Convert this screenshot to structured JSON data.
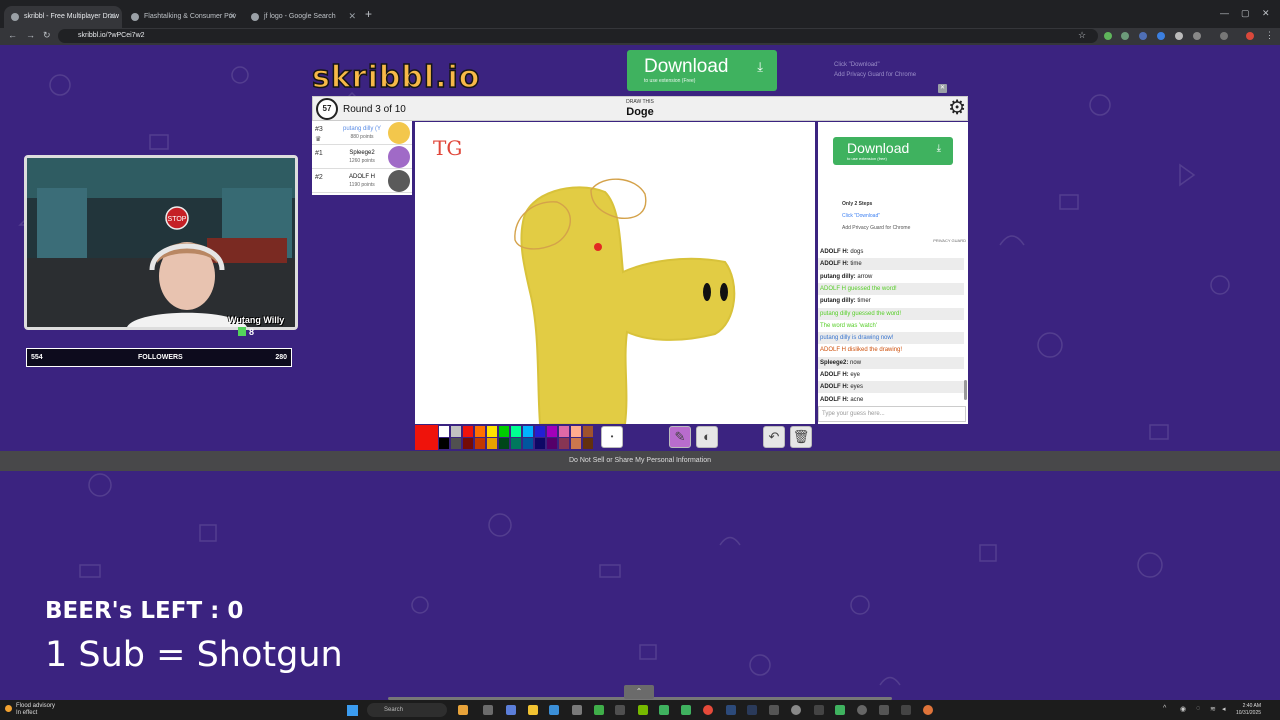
{
  "browser": {
    "tabs": [
      {
        "title": "skribbl - Free Multiplayer Draw",
        "active": true
      },
      {
        "title": "Flashtalking & Consumer Priv",
        "active": false
      },
      {
        "title": "jf logo - Google Search",
        "active": false
      }
    ],
    "url": "skribbl.io/?wPCei7w2"
  },
  "game": {
    "logo": "skribbl.io",
    "download": {
      "label": "Download",
      "sub": "to use extension (Free)"
    },
    "ad_note": {
      "line1": "Click \"Download\"",
      "line2": "Add Privacy Guard for Chrome"
    },
    "timer": "57",
    "round": "Round 3 of 10",
    "draw_this": "DRAW THIS",
    "word": "Doge",
    "players": [
      {
        "rank": "#3",
        "name": "putang dilly (Y",
        "points": "880 points",
        "me": true,
        "color": "#f3c74c"
      },
      {
        "rank": "#1",
        "name": "Spleege2",
        "points": "1260 points",
        "me": false,
        "color": "#a06ac7"
      },
      {
        "rank": "#2",
        "name": "ADOLF H",
        "points": "1190 points",
        "me": false,
        "color": "#5a5a5a"
      }
    ],
    "canvas_text": "TG",
    "side_ad": {
      "download": "Download",
      "download_sub": "to use extension (free)",
      "steps_title": "Only 2 Steps",
      "step1": "Click \"Download\"",
      "step2": "Add Privacy Guard for Chrome",
      "brand": "PRIVACY GUARD"
    },
    "chat": [
      {
        "user": "ADOLF H:",
        "msg": "dogs",
        "style": "normal"
      },
      {
        "user": "ADOLF H:",
        "msg": "time",
        "style": "normal"
      },
      {
        "user": "putang dilly:",
        "msg": "arrow",
        "style": "normal"
      },
      {
        "user": "",
        "msg": "ADOLF H guessed the word!",
        "style": "green"
      },
      {
        "user": "putang dilly:",
        "msg": "timer",
        "style": "normal"
      },
      {
        "user": "",
        "msg": "putang dilly guessed the word!",
        "style": "green"
      },
      {
        "user": "",
        "msg": "The word was 'watch'",
        "style": "green"
      },
      {
        "user": "",
        "msg": "putang dilly is drawing now!",
        "style": "blue"
      },
      {
        "user": "",
        "msg": "ADOLF H disliked the drawing!",
        "style": "red"
      },
      {
        "user": "Spleege2:",
        "msg": "now",
        "style": "normal"
      },
      {
        "user": "ADOLF H:",
        "msg": "eye",
        "style": "normal"
      },
      {
        "user": "ADOLF H:",
        "msg": "eyes",
        "style": "normal"
      },
      {
        "user": "ADOLF H:",
        "msg": "acne",
        "style": "normal"
      }
    ],
    "chat_placeholder": "Type your guess here...",
    "palette": [
      "#ffffff",
      "#c1c1c1",
      "#ef130b",
      "#ff7100",
      "#ffe400",
      "#00cc00",
      "#00ff91",
      "#00b2ff",
      "#231fd3",
      "#a300ba",
      "#df69a7",
      "#ffac8e",
      "#a0522d",
      "#000000",
      "#505050",
      "#740b07",
      "#c23800",
      "#e8a200",
      "#004619",
      "#00785d",
      "#00569e",
      "#0e0865",
      "#550069",
      "#873554",
      "#cc774d",
      "#63300d"
    ],
    "footer": "Do Not Sell or Share My Personal Information"
  },
  "overlay": {
    "cam_name": "Wutang Willy",
    "cam_count": "8",
    "followers_left": "554",
    "followers_label": "FOLLOWERS",
    "followers_right": "280",
    "beers": "BEER's LEFT : 0",
    "shotgun": "1 Sub = Shotgun"
  },
  "taskbar": {
    "weather_title": "Flood advisory",
    "weather_sub": "In effect",
    "search": "Search",
    "time": "2:40 AM",
    "date": "10/31/2025"
  }
}
